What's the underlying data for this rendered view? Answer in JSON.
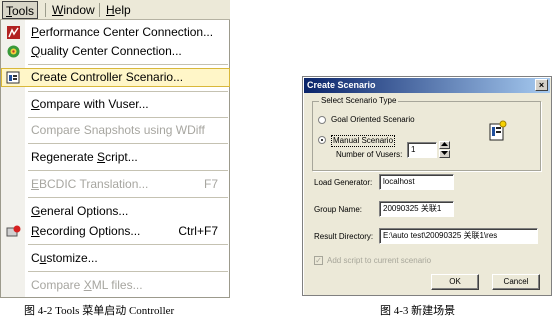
{
  "menubar": {
    "items": [
      {
        "label": "Tools",
        "mnemonic": "T"
      },
      {
        "label": "Window",
        "mnemonic": "W"
      },
      {
        "label": "Help",
        "mnemonic": "H"
      }
    ]
  },
  "tools_menu": {
    "items": [
      {
        "label": "Performance Center Connection...",
        "mnemonic": "P",
        "icon": "performance-center-icon",
        "enabled": true
      },
      {
        "label": "Quality Center Connection...",
        "mnemonic": "Q",
        "icon": "quality-center-icon",
        "enabled": true
      },
      {
        "label": "Create Controller Scenario...",
        "mnemonic": "",
        "icon": "controller-scenario-icon",
        "enabled": true,
        "highlighted": true
      },
      {
        "label": "Compare with Vuser...",
        "mnemonic": "C",
        "enabled": true
      },
      {
        "label": "Compare Snapshots using WDiff",
        "mnemonic": "",
        "enabled": false
      },
      {
        "label": "Regenerate Script...",
        "mnemonic": "S",
        "enabled": true
      },
      {
        "label": "EBCDIC Translation...",
        "mnemonic": "E",
        "accelerator": "F7",
        "enabled": false
      },
      {
        "label": "General Options...",
        "mnemonic": "G",
        "enabled": true
      },
      {
        "label": "Recording Options...",
        "mnemonic": "R",
        "accelerator": "Ctrl+F7",
        "icon": "recording-options-icon",
        "enabled": true
      },
      {
        "label": "Customize...",
        "mnemonic": "u",
        "enabled": true
      },
      {
        "label": "Compare XML files...",
        "mnemonic": "X",
        "enabled": false
      }
    ]
  },
  "captions": {
    "left": "图 4-2   Tools 菜单启动 Controller",
    "right": "图 4-3   新建场景"
  },
  "dialog": {
    "title": "Create Scenario",
    "close_glyph": "×",
    "group_label": "Select Scenario Type",
    "goal_oriented_label": "Goal Oriented Scenario",
    "manual_label": "Manual Scenario",
    "manual_selected": true,
    "vusers_label": "Number of Vusers:",
    "vusers_value": "1",
    "load_generator_label": "Load Generator:",
    "load_generator_value": "localhost",
    "group_name_label": "Group Name:",
    "group_name_value": "20090325 关联1",
    "result_directory_label": "Result Directory:",
    "result_directory_value": "E:\\auto test\\20090325 关联1\\res",
    "add_script_label": "Add script to current scenario",
    "add_script_checked": true,
    "add_script_enabled": false,
    "ok_label": "OK",
    "cancel_label": "Cancel"
  }
}
